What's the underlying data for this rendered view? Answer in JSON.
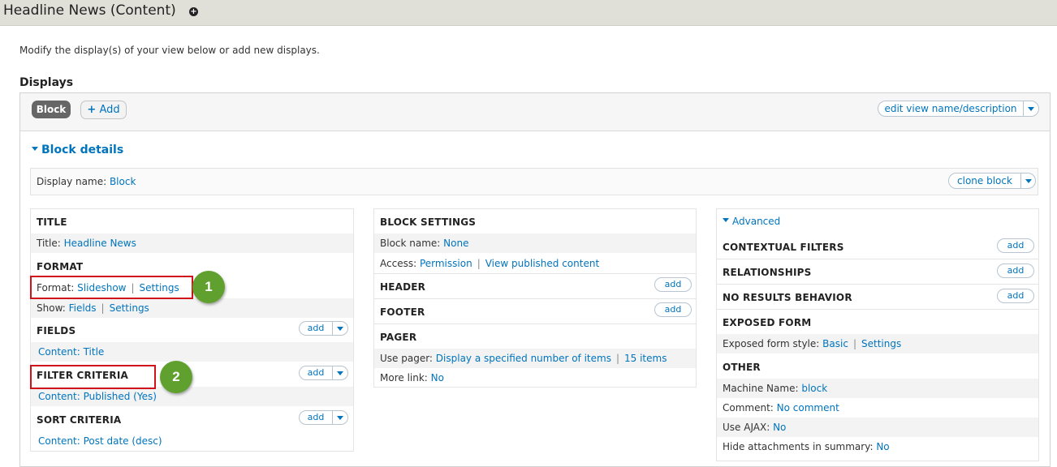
{
  "header": {
    "title": "Headline News (Content)",
    "shortcut_symbol": "+"
  },
  "intro": "Modify the display(s) of your view below or add new displays.",
  "displays_heading": "Displays",
  "tabs": {
    "block": "Block",
    "add": "Add",
    "add_icon": "+",
    "edit_view": "edit view name/description"
  },
  "block_details": {
    "toggle": "Block details",
    "display_name_label": "Display name:",
    "display_name_value": "Block",
    "clone": "clone block"
  },
  "left": {
    "title_section": "TITLE",
    "title_label": "Title:",
    "title_value": "Headline News",
    "format_section": "FORMAT",
    "format_label": "Format:",
    "format_value": "Slideshow",
    "format_settings": "Settings",
    "show_label": "Show:",
    "show_value": "Fields",
    "show_settings": "Settings",
    "fields_section": "FIELDS",
    "fields_item": "Content: Title",
    "filter_section": "FILTER CRITERIA",
    "filter_item": "Content: Published (Yes)",
    "sort_section": "SORT CRITERIA",
    "sort_item": "Content: Post date (desc)",
    "add": "add"
  },
  "middle": {
    "block_settings": "BLOCK SETTINGS",
    "block_name_label": "Block name:",
    "block_name_value": "None",
    "access_label": "Access:",
    "access_value": "Permission",
    "access_extra": "View published content",
    "header_section": "HEADER",
    "footer_section": "FOOTER",
    "pager_section": "PAGER",
    "use_pager_label": "Use pager:",
    "use_pager_value": "Display a specified number of items",
    "use_pager_items": "15 items",
    "more_link_label": "More link:",
    "more_link_value": "No",
    "add": "add"
  },
  "right": {
    "advanced": "Advanced",
    "contextual": "CONTEXTUAL FILTERS",
    "relationships": "RELATIONSHIPS",
    "no_results": "NO RESULTS BEHAVIOR",
    "exposed_form": "EXPOSED FORM",
    "exposed_style_label": "Exposed form style:",
    "exposed_style_value": "Basic",
    "exposed_settings": "Settings",
    "other": "OTHER",
    "machine_label": "Machine Name:",
    "machine_value": "block",
    "comment_label": "Comment:",
    "comment_value": "No comment",
    "ajax_label": "Use AJAX:",
    "ajax_value": "No",
    "hide_label": "Hide attachments in summary:",
    "hide_value": "No",
    "add": "add"
  },
  "badges": {
    "one": "1",
    "two": "2"
  },
  "separator": "|",
  "colors": {
    "link": "#0074bd",
    "badge": "#5fa02e",
    "highlight": "#d0121b"
  }
}
